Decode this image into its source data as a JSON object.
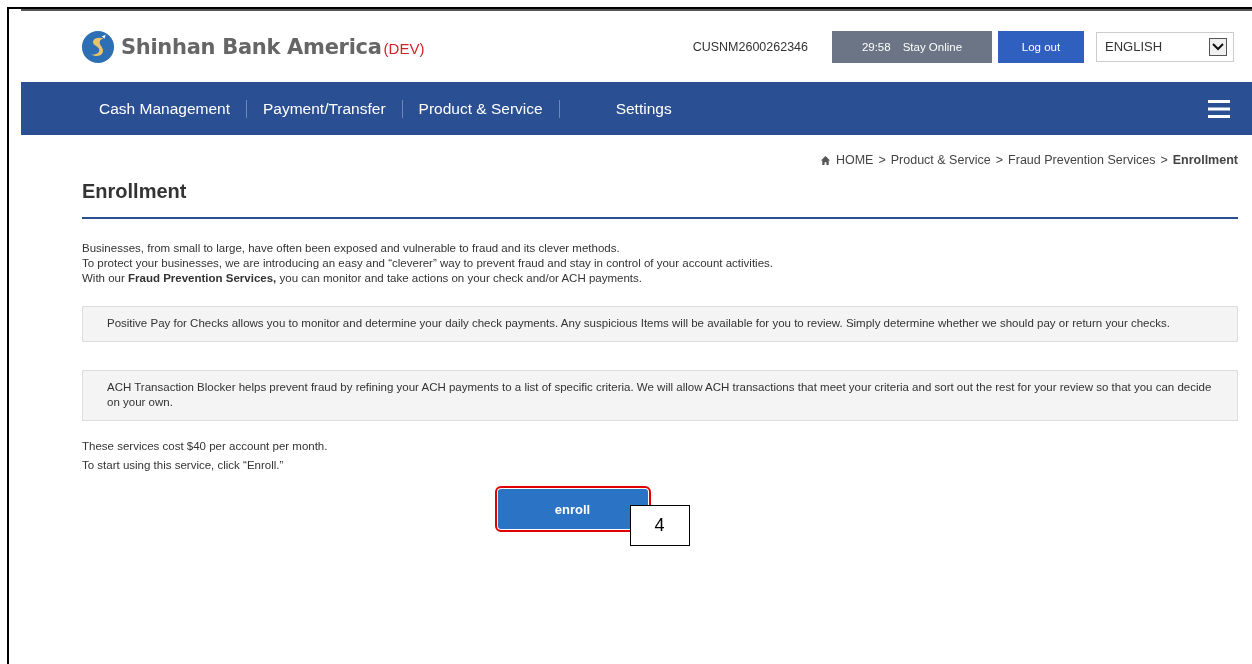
{
  "header": {
    "bank_name": "Shinhan Bank America",
    "env_badge": "(DEV)",
    "user_id": "CUSNM2600262346",
    "session": {
      "timer": "29:58",
      "label": "Stay Online"
    },
    "logout": "Log out",
    "language": {
      "value": "ENGLISH"
    }
  },
  "nav": {
    "items": [
      {
        "label": "Cash Management"
      },
      {
        "label": "Payment/Transfer"
      },
      {
        "label": "Product & Service"
      },
      {
        "label": "Settings"
      }
    ]
  },
  "breadcrumb": {
    "separator": ">",
    "items": [
      "HOME",
      "Product & Service",
      "Fraud Prevention Services"
    ],
    "current": "Enrollment"
  },
  "page_title": "Enrollment",
  "intro": [
    "Businesses, from small to large,  have often been exposed and vulnerable to fraud and its clever methods.",
    "To protect your businesses, we are introducing an easy and “cleverer” way to prevent fraud and stay in control of your account activities.",
    "With our **Fraud Prevention Services,** you can monitor and take actions on your check and/or ACH payments."
  ],
  "services": [
    {
      "description": "Positive Pay for Checks allows you to monitor and determine your daily check payments. Any suspicious Items will be available for you to review. Simply determine whether we should pay or return your checks."
    },
    {
      "description": "ACH Transaction Blocker helps prevent fraud by refining your ACH payments to a list of specific criteria. We will allow ACH transactions that meet your criteria and sort out the rest for your review so that you can decide on your own."
    }
  ],
  "notes": [
    "These services cost $40 per account per month.",
    "To start using this service, click “Enroll.”"
  ],
  "enroll_button": {
    "label": "enroll",
    "highlighted": true,
    "callout": "4"
  }
}
